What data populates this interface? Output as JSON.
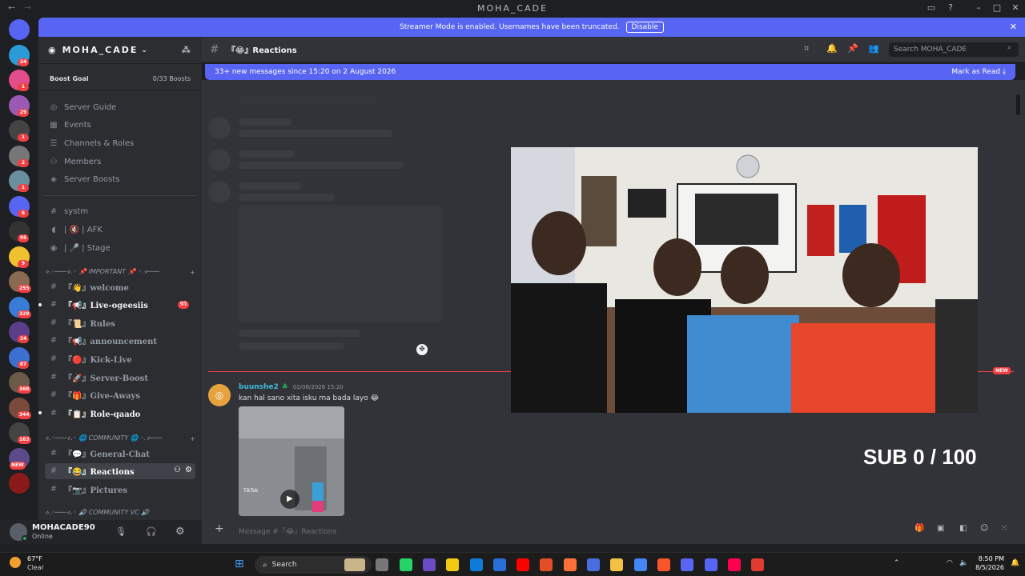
{
  "window": {
    "title": "MOHA_CADE"
  },
  "banner": {
    "text": "Streamer Mode is enabled. Usernames have been truncated.",
    "disable_label": "Disable"
  },
  "rail_badges": [
    "24",
    "1",
    "29",
    "1",
    "2",
    "1",
    "6",
    "95",
    "9",
    "255",
    "329",
    "24",
    "87",
    "368",
    "344",
    "163",
    "NEW"
  ],
  "server": {
    "name": "MOHA_CADE",
    "boost_goal_label": "Boost Goal",
    "boost_goal_value": "0/33 Boosts"
  },
  "nav": [
    {
      "label": "Server Guide",
      "icon": "compass-icon"
    },
    {
      "label": "Events",
      "icon": "calendar-icon"
    },
    {
      "label": "Channels & Roles",
      "icon": "list-icon"
    },
    {
      "label": "Members",
      "icon": "members-icon"
    },
    {
      "label": "Server Boosts",
      "icon": "boost-icon"
    }
  ],
  "top_channels": [
    {
      "label": "systm",
      "icon": "hash-icon"
    },
    {
      "label": "| 🔇 | AFK",
      "icon": "speaker-icon"
    },
    {
      "label": "| 🎤 | Stage",
      "icon": "stage-icon"
    }
  ],
  "categories": {
    "important": "⟡.◦───⟡.◦ 📌 IMPORTANT 📌 ◦.⟡───",
    "community": "⟡.◦───⟡.◦ 🌐 COMMUNITY 🌐 ◦.⟡───",
    "community_vc": "⟡.◦───⟡.◦ 🔊 COMMUNITY VC 🔊"
  },
  "channels_important": [
    {
      "label": "『👋』welcome",
      "unread": false
    },
    {
      "label": "『📢』Live-ogeesiis",
      "unread": true,
      "badge": "95"
    },
    {
      "label": "『📜』Rules",
      "unread": false
    },
    {
      "label": "『📢』announcement",
      "unread": false
    },
    {
      "label": "『🔴』Kick-Live",
      "unread": false
    },
    {
      "label": "『🚀』Server-Boost",
      "unread": false
    },
    {
      "label": "『🎁』Give-Aways",
      "unread": false
    },
    {
      "label": "『📋』Role-qaado",
      "unread": true
    }
  ],
  "channels_community": [
    {
      "label": "『💬』General-Chat",
      "unread": false
    },
    {
      "label": "『😂』Reactions",
      "selected": true
    },
    {
      "label": "『📷』Pictures",
      "unread": false
    }
  ],
  "user": {
    "name": "MOHACADE90",
    "status": "Online"
  },
  "channel_header": {
    "name": "『😂』Reactions",
    "search_placeholder": "Search MOHA_CADE"
  },
  "new_messages": {
    "text": "33+ new messages since 15:20 on 2 August 2026",
    "mark_read": "Mark as Read"
  },
  "new_divider": "NEW",
  "message": {
    "author": "buunshe2",
    "timestamp": "02/08/2026 15:20",
    "content": "kan hal sano xita isku ma bada layo 😂",
    "video_caption": "TikTok"
  },
  "composer": {
    "placeholder": "Message #『😂』Reactions"
  },
  "stream": {
    "subcount": "SUB 0 / 100"
  },
  "taskbar": {
    "weather_temp": "67°F",
    "weather_cond": "Clear",
    "search": "Search",
    "time": "8:50 PM",
    "date": "8/5/2026"
  },
  "colors": {
    "blurple": "#5865f2",
    "red": "#f23f43",
    "sidebar": "#2b2d31",
    "chat": "#313338"
  }
}
